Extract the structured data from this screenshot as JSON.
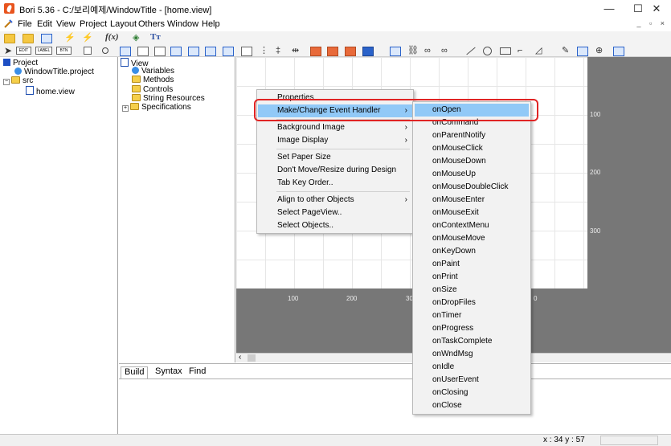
{
  "window": {
    "title": "Bori 5.36 - C:/보리예제/WindowTitle - [home.view]",
    "minimize": "—",
    "maximize": "☐",
    "close": "✕"
  },
  "menubar": {
    "items": [
      "File",
      "Edit",
      "View",
      "Project",
      "Layout",
      "Others",
      "Window",
      "Help"
    ],
    "mdi_controls": "_ ▫ ×"
  },
  "toolbar2": {
    "edit_label": "EDIT",
    "label_label": "LABEL",
    "btn_label": "BTN",
    "fx_label": "f(x)",
    "text_label": "Tт"
  },
  "project_tree": {
    "root": "Project",
    "project_file": "WindowTitle.project",
    "src_folder": "src",
    "view_file": "home.view"
  },
  "view_tree": {
    "root": "View",
    "items": [
      "Variables",
      "Methods",
      "Controls",
      "String Resources",
      "Specifications"
    ]
  },
  "ruler": {
    "vertical": [
      "100",
      "200",
      "300"
    ],
    "horizontal": [
      "100",
      "200",
      "30",
      "0"
    ]
  },
  "context_menu": {
    "items": [
      {
        "label": "Properties",
        "submenu": false
      },
      {
        "label": "Make/Change Event Handler",
        "submenu": true,
        "highlighted": true
      },
      {
        "label": "Background Image",
        "submenu": true
      },
      {
        "label": "Image Display",
        "submenu": true
      },
      {
        "label": "Set Paper Size",
        "submenu": false
      },
      {
        "label": "Don't Move/Resize during Design",
        "submenu": false
      },
      {
        "label": "Tab Key Order..",
        "submenu": false
      },
      {
        "label": "Align to other Objects",
        "submenu": true
      },
      {
        "label": "Select PageView..",
        "submenu": false
      },
      {
        "label": "Select Objects..",
        "submenu": false
      }
    ],
    "arrow": "›"
  },
  "event_submenu": {
    "items": [
      "onOpen",
      "onCommand",
      "onParentNotify",
      "onMouseClick",
      "onMouseDown",
      "onMouseUp",
      "onMouseDoubleClick",
      "onMouseEnter",
      "onMouseExit",
      "onContextMenu",
      "onMouseMove",
      "onKeyDown",
      "onPaint",
      "onPrint",
      "onSize",
      "onDropFiles",
      "onTimer",
      "onProgress",
      "onTaskComplete",
      "onWndMsg",
      "onIdle",
      "onUserEvent",
      "onClosing",
      "onClose"
    ],
    "highlighted_index": 0
  },
  "output_tabs": [
    "Build",
    "Syntax",
    "Find"
  ],
  "status": {
    "coords": "x : 34  y : 57"
  },
  "colors": {
    "highlight": "#91c9f7",
    "annotation": "#e02424",
    "canvas": "#777777"
  }
}
